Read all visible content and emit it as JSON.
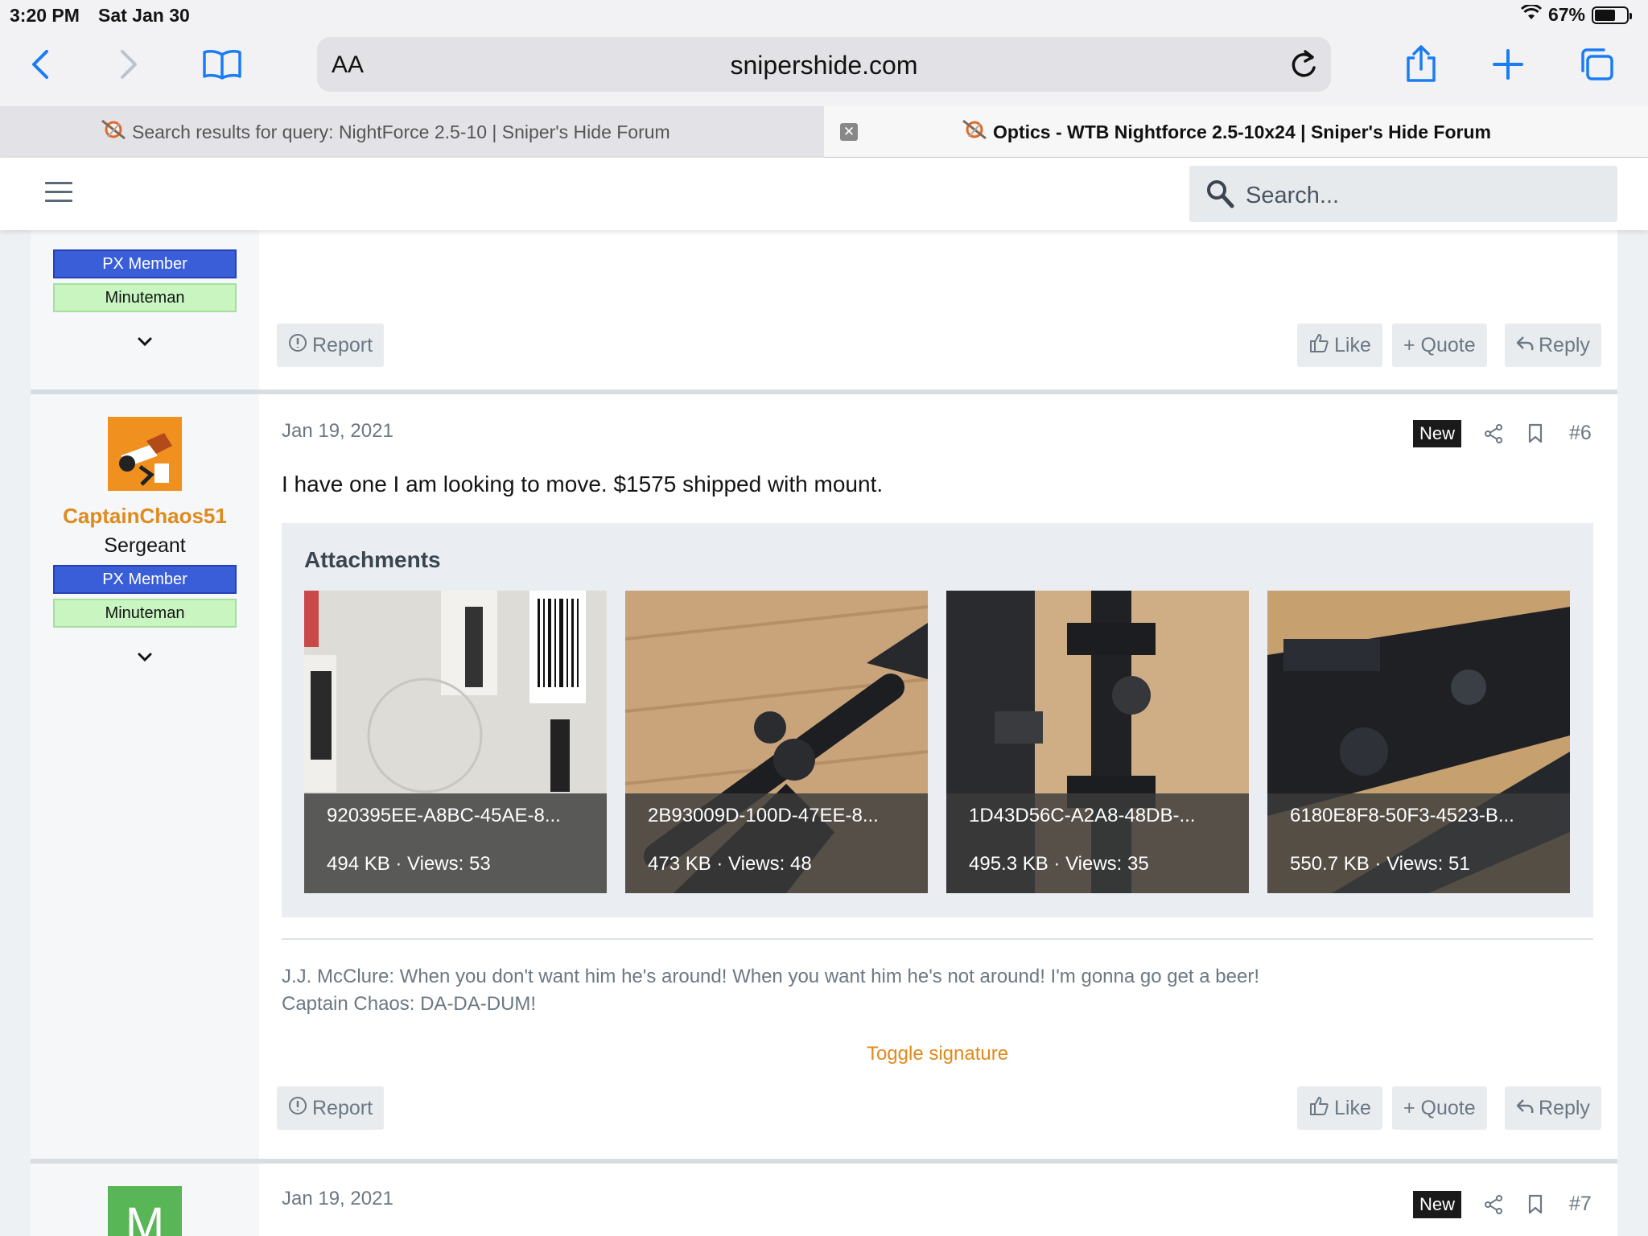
{
  "status": {
    "time": "3:20 PM",
    "date": "Sat Jan 30",
    "battery": "67%",
    "battery_level": 0.67
  },
  "browser": {
    "reader_label": "AA",
    "url": "snipershide.com",
    "tabs": [
      {
        "title": "Search results for query: NightForce 2.5-10 | Sniper's Hide Forum",
        "active": false
      },
      {
        "title": "Optics - WTB Nightforce 2.5-10x24 | Sniper's Hide Forum",
        "active": true
      }
    ]
  },
  "forum": {
    "search_placeholder": "Search..."
  },
  "post_prev": {
    "badges": [
      "PX Member",
      "Minuteman"
    ],
    "actions": {
      "report": "Report",
      "like": "Like",
      "quote": "+ Quote",
      "reply": "Reply"
    }
  },
  "post6": {
    "username": "CaptainChaos51",
    "user_title": "Sergeant",
    "badges": [
      "PX Member",
      "Minuteman"
    ],
    "date": "Jan 19, 2021",
    "new_label": "New",
    "number": "#6",
    "message": "I have one I am looking to move. $1575 shipped with mount.",
    "attachments_title": "Attachments",
    "attachments": [
      {
        "filename": "920395EE-A8BC-45AE-8...",
        "meta": "494 KB · Views: 53"
      },
      {
        "filename": "2B93009D-100D-47EE-8...",
        "meta": "473 KB · Views: 48"
      },
      {
        "filename": "1D43D56C-A2A8-48DB-...",
        "meta": "495.3 KB · Views: 35"
      },
      {
        "filename": "6180E8F8-50F3-4523-B...",
        "meta": "550.7 KB · Views: 51"
      }
    ],
    "signature": [
      "J.J. McClure: When you don't want him he's around! When you want him he's not around! I'm gonna go get a beer!",
      "Captain Chaos: DA-DA-DUM!"
    ],
    "toggle_signature": "Toggle signature",
    "actions": {
      "report": "Report",
      "like": "Like",
      "quote": "+ Quote",
      "reply": "Reply"
    }
  },
  "post7": {
    "avatar_letter": "M",
    "date": "Jan 19, 2021",
    "new_label": "New",
    "number": "#7"
  },
  "colors": {
    "accent": "#e08a1c",
    "px_member": "#3a5ed8",
    "minuteman": "#c8f5c0",
    "safari_blue": "#1a7cf5"
  }
}
